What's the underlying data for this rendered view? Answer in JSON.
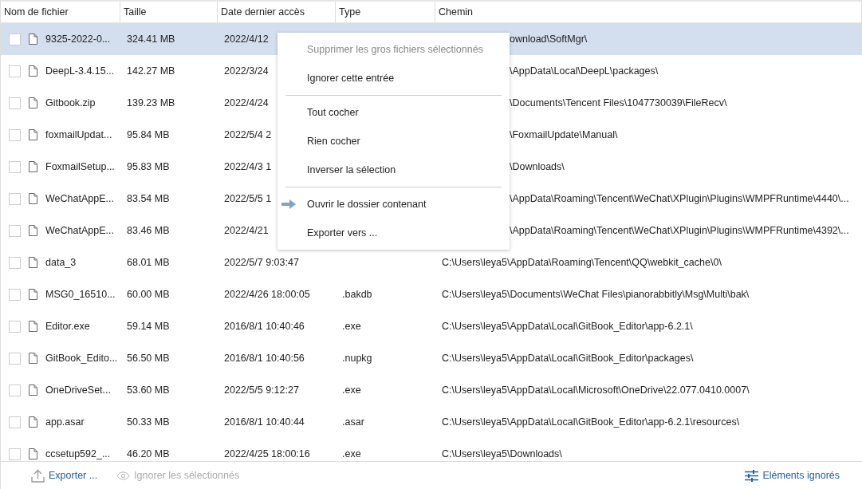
{
  "table": {
    "columns": [
      "Nom de fichier",
      "Taille",
      "Date dernier accès",
      "Type",
      "Chemin"
    ],
    "rows": [
      {
        "kind": "covered",
        "selected": true,
        "checked": false,
        "name": "9325-2022-0...",
        "size": "324.41 MB",
        "date": "2022/4/12",
        "type": "",
        "path": "ownload\\SoftMgr\\"
      },
      {
        "kind": "covered",
        "selected": false,
        "checked": false,
        "name": "DeepL-3.4.15...",
        "size": "142.27 MB",
        "date": "2022/3/24",
        "type": "",
        "path": "\\AppData\\Local\\DeepL\\packages\\"
      },
      {
        "kind": "covered",
        "selected": false,
        "checked": false,
        "name": "Gitbook.zip",
        "size": "139.23 MB",
        "date": "2022/4/24",
        "type": "",
        "path": "\\Documents\\Tencent Files\\1047730039\\FileRecv\\"
      },
      {
        "kind": "covered",
        "selected": false,
        "checked": false,
        "name": "foxmailUpdat...",
        "size": "95.84 MB",
        "date": "2022/5/4 2",
        "type": "",
        "path": "\\FoxmailUpdate\\Manual\\"
      },
      {
        "kind": "covered",
        "selected": false,
        "checked": false,
        "name": "FoxmailSetup...",
        "size": "95.83 MB",
        "date": "2022/4/3 1",
        "type": "",
        "path": "\\Downloads\\"
      },
      {
        "kind": "covered",
        "selected": false,
        "checked": false,
        "name": "WeChatAppE...",
        "size": "83.54 MB",
        "date": "2022/5/5 1",
        "type": "",
        "path": "\\AppData\\Roaming\\Tencent\\WeChat\\XPlugin\\Plugins\\WMPFRuntime\\4440\\..."
      },
      {
        "kind": "covered",
        "selected": false,
        "checked": false,
        "name": "WeChatAppE...",
        "size": "83.46 MB",
        "date": "2022/4/21",
        "type": "",
        "path": "\\AppData\\Roaming\\Tencent\\WeChat\\XPlugin\\Plugins\\WMPFRuntime\\4392\\..."
      },
      {
        "kind": "full",
        "selected": false,
        "checked": false,
        "name": "data_3",
        "size": "68.01 MB",
        "date": "2022/5/7 9:03:47",
        "type": "",
        "path": "C:\\Users\\leya5\\AppData\\Roaming\\Tencent\\QQ\\webkit_cache\\0\\"
      },
      {
        "kind": "full",
        "selected": false,
        "checked": false,
        "name": "MSG0_16510...",
        "size": "60.00 MB",
        "date": "2022/4/26 18:00:05",
        "type": ".bakdb",
        "path": "C:\\Users\\leya5\\Documents\\WeChat Files\\pianorabbitly\\Msg\\Multi\\bak\\"
      },
      {
        "kind": "full",
        "selected": false,
        "checked": false,
        "name": "Editor.exe",
        "size": "59.14 MB",
        "date": "2016/8/1 10:40:46",
        "type": ".exe",
        "path": "C:\\Users\\leya5\\AppData\\Local\\GitBook_Editor\\app-6.2.1\\"
      },
      {
        "kind": "full",
        "selected": false,
        "checked": false,
        "name": "GitBook_Edito...",
        "size": "56.50 MB",
        "date": "2016/8/1 10:40:56",
        "type": ".nupkg",
        "path": "C:\\Users\\leya5\\AppData\\Local\\GitBook_Editor\\packages\\"
      },
      {
        "kind": "full",
        "selected": false,
        "checked": false,
        "name": "OneDriveSet...",
        "size": "53.60 MB",
        "date": "2022/5/5 9:12:27",
        "type": ".exe",
        "path": "C:\\Users\\leya5\\AppData\\Local\\Microsoft\\OneDrive\\22.077.0410.0007\\"
      },
      {
        "kind": "full",
        "selected": false,
        "checked": false,
        "name": "app.asar",
        "size": "50.33 MB",
        "date": "2016/8/1 10:40:44",
        "type": ".asar",
        "path": "C:\\Users\\leya5\\AppData\\Local\\GitBook_Editor\\app-6.2.1\\resources\\"
      },
      {
        "kind": "full",
        "selected": false,
        "checked": false,
        "name": "ccsetup592_...",
        "size": "46.20 MB",
        "date": "2022/4/25 18:00:16",
        "type": ".exe",
        "path": "C:\\Users\\leya5\\Downloads\\"
      }
    ]
  },
  "context_menu": {
    "items": [
      {
        "kind": "item",
        "label": "Supprimer les gros fichiers sélectionnés",
        "disabled": true,
        "icon": false
      },
      {
        "kind": "item",
        "label": "Ignorer cette entrée",
        "disabled": false,
        "icon": false
      },
      {
        "kind": "separator"
      },
      {
        "kind": "item",
        "label": "Tout cocher",
        "disabled": false,
        "icon": false
      },
      {
        "kind": "item",
        "label": "Rien cocher",
        "disabled": false,
        "icon": false
      },
      {
        "kind": "item",
        "label": "Inverser la sélection",
        "disabled": false,
        "icon": false
      },
      {
        "kind": "separator"
      },
      {
        "kind": "item",
        "label": "Ouvrir le dossier contenant",
        "disabled": false,
        "icon": true
      },
      {
        "kind": "item",
        "label": "Exporter vers ...",
        "disabled": false,
        "icon": false
      }
    ]
  },
  "footer": {
    "export": {
      "label": "Exporter ...",
      "disabled": false
    },
    "ignore_selected": {
      "label": "Ignorer les sélectionnés",
      "disabled": true
    },
    "ignored": {
      "label": "Eléments ignorés"
    }
  }
}
